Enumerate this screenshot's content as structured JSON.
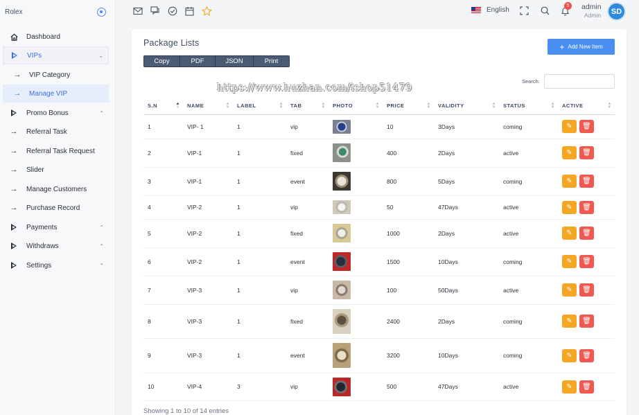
{
  "sidebar": {
    "brand": "Rolex",
    "items": [
      {
        "label": "Dashboard",
        "icon": "home-icon"
      },
      {
        "label": "VIPs",
        "icon": "caret-right-icon"
      },
      {
        "label": "VIP Category",
        "icon": "arrow-right-icon"
      },
      {
        "label": "Manage VIP",
        "icon": "arrow-right-icon"
      },
      {
        "label": "Promo Bonus",
        "icon": "caret-right-icon"
      },
      {
        "label": "Referral Task",
        "icon": "arrow-right-icon"
      },
      {
        "label": "Referral Task Request",
        "icon": "arrow-right-icon"
      },
      {
        "label": "Slider",
        "icon": "arrow-right-icon"
      },
      {
        "label": "Manage Customers",
        "icon": "arrow-right-icon"
      },
      {
        "label": "Purchase Record",
        "icon": "arrow-right-icon"
      },
      {
        "label": "Payments",
        "icon": "caret-right-icon"
      },
      {
        "label": "Withdraws",
        "icon": "caret-right-icon"
      },
      {
        "label": "Settings",
        "icon": "caret-right-icon"
      }
    ]
  },
  "topbar": {
    "language": "English",
    "notification_count": "5",
    "user_name": "admin",
    "user_role": "Admin",
    "avatar_text": "SD"
  },
  "card": {
    "title": "Package Lists",
    "add_button": "Add New Item",
    "export_buttons": [
      "Copy",
      "PDF",
      "JSON",
      "Print"
    ],
    "search_label": "Search:",
    "search_value": "",
    "watermark": "https://www.huzhan.com/ishop51479",
    "columns": [
      "S.N",
      "NAME",
      "LABEL",
      "TAB",
      "PHOTO",
      "PRICE",
      "VALIDITY",
      "STATUS",
      "ACTIVE"
    ],
    "rows": [
      {
        "sn": "1",
        "name": "VIP- 1",
        "label": "1",
        "tab": "vip",
        "price": "10",
        "validity": "3Days",
        "status": "coming"
      },
      {
        "sn": "2",
        "name": "VIP-1",
        "label": "1",
        "tab": "fixed",
        "price": "400",
        "validity": "2Days",
        "status": "active"
      },
      {
        "sn": "3",
        "name": "VIP-1",
        "label": "1",
        "tab": "event",
        "price": "800",
        "validity": "5Days",
        "status": "coming"
      },
      {
        "sn": "4",
        "name": "VIP-2",
        "label": "1",
        "tab": "vip",
        "price": "50",
        "validity": "47Days",
        "status": "active"
      },
      {
        "sn": "5",
        "name": "VIP-2",
        "label": "1",
        "tab": "fixed",
        "price": "1000",
        "validity": "2Days",
        "status": "active"
      },
      {
        "sn": "6",
        "name": "VIP-2",
        "label": "1",
        "tab": "event",
        "price": "1500",
        "validity": "10Days",
        "status": "coming"
      },
      {
        "sn": "7",
        "name": "VIP-3",
        "label": "1",
        "tab": "vip",
        "price": "100",
        "validity": "50Days",
        "status": "active"
      },
      {
        "sn": "8",
        "name": "VIP-3",
        "label": "1",
        "tab": "fixed",
        "price": "2400",
        "validity": "2Days",
        "status": "coming"
      },
      {
        "sn": "9",
        "name": "VIP-3",
        "label": "1",
        "tab": "event",
        "price": "3200",
        "validity": "10Days",
        "status": "coming"
      },
      {
        "sn": "10",
        "name": "VIP-4",
        "label": "3",
        "tab": "vip",
        "price": "500",
        "validity": "47Days",
        "status": "active"
      }
    ],
    "footer": "Showing 1 to 10 of 14 entries"
  },
  "colors": {
    "accent": "#4a8ef2",
    "edit": "#f5a623",
    "delete": "#ee5a52",
    "export_button": "#4b5b74"
  }
}
